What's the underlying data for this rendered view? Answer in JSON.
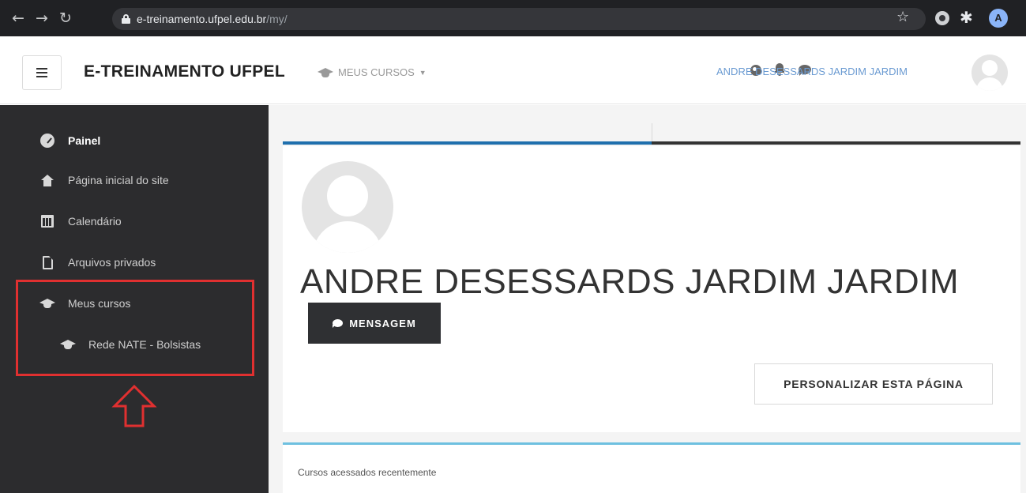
{
  "browser": {
    "url_host": "e-treinamento.ufpel.edu.br",
    "url_path": "/my/",
    "profile_initial": "A"
  },
  "navbar": {
    "site_name": "E-TREINAMENTO UFPEL",
    "my_courses_label": "MEUS CURSOS",
    "user_name": "ANDRE DESESSARDS JARDIM JARDIM"
  },
  "sidebar": {
    "items": [
      {
        "label": "Painel",
        "icon": "dashboard-icon"
      },
      {
        "label": "Página inicial do site",
        "icon": "home-icon"
      },
      {
        "label": "Calendário",
        "icon": "calendar-icon"
      },
      {
        "label": "Arquivos privados",
        "icon": "file-icon"
      },
      {
        "label": "Meus cursos",
        "icon": "graduation-cap-icon"
      },
      {
        "label": "Rede NATE - Bolsistas",
        "icon": "graduation-cap-icon"
      }
    ]
  },
  "profile": {
    "name": "ANDRE DESESSARDS JARDIM JARDIM",
    "message_button": "MENSAGEM",
    "customize_button": "PERSONALIZAR ESTA PÁGINA"
  },
  "recent": {
    "title": "Cursos acessados recentemente"
  },
  "colors": {
    "sidebar_bg": "#2c2c2e",
    "accent_blue": "#1f6fad",
    "highlight_red": "#e03030",
    "user_link": "#6b9bd2"
  }
}
